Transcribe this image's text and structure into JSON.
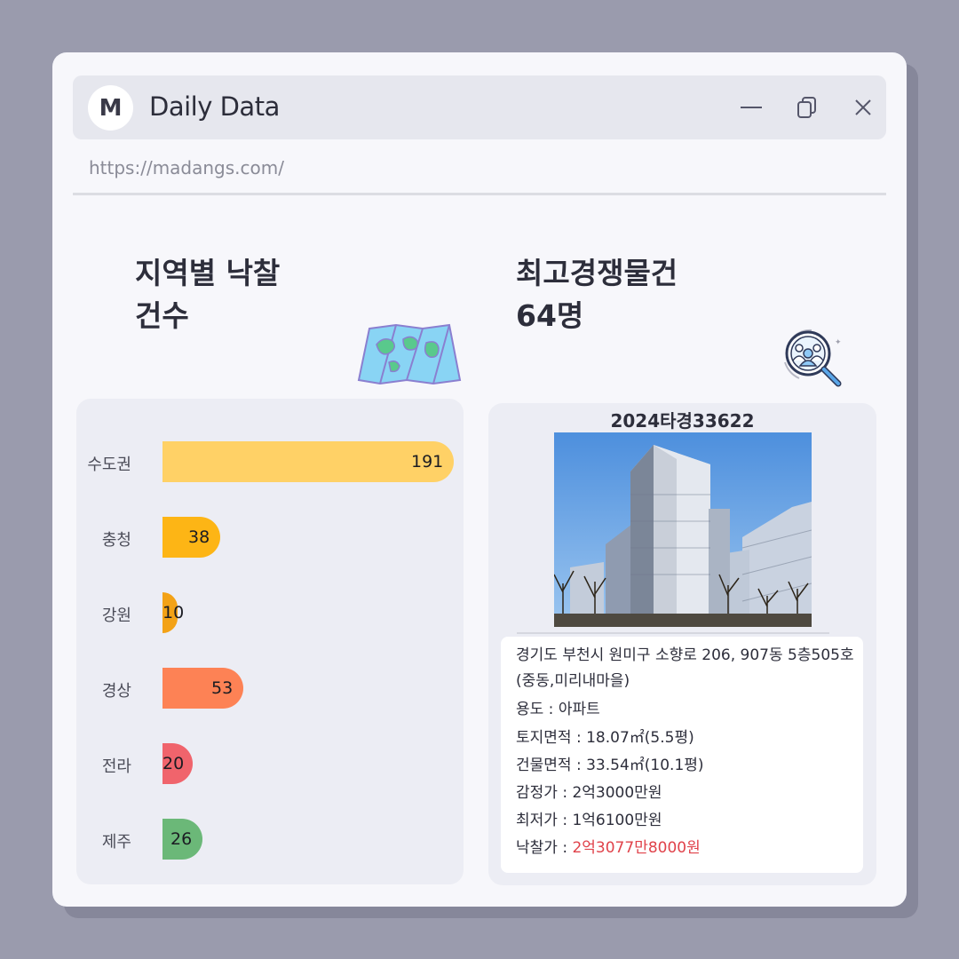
{
  "window": {
    "logo_letter": "M",
    "title": "Daily Data",
    "url": "https://madangs.com/",
    "icons": [
      "minimize-icon",
      "copy-icon",
      "close-icon"
    ]
  },
  "left": {
    "title_line1": "지역별 낙찰",
    "title_line2": "건수",
    "icon": "map-icon"
  },
  "right": {
    "title_line1": "최고경쟁물건",
    "title_line2": "64명",
    "icon": "search-people-icon",
    "case_number": "2024타경33622",
    "address_line1": "경기도 부천시 원미구 소향로 206, 907동 5층505호",
    "address_line2": "(중동,미리내마을)",
    "usage_label": "용도 : ",
    "usage_value": "아파트",
    "land_label": "토지면적 : ",
    "land_value": "18.07㎡(5.5평)",
    "building_label": "건물면적 : ",
    "building_value": "33.54㎡(10.1평)",
    "appraisal_label": "감정가 : ",
    "appraisal_value": "2억3000만원",
    "minimum_label": "최저가 : ",
    "minimum_value": "1억6100만원",
    "winning_label": "낙찰가 : ",
    "winning_value": "2억3077만8000원"
  },
  "colors": {
    "수도권": "#ffd166",
    "충청": "#fdb515",
    "강원": "#f3a216",
    "경상": "#fd8255",
    "전라": "#f0646c",
    "제주": "#6bb878",
    "highlight": "#e0424a"
  },
  "chart_data": {
    "type": "bar",
    "orientation": "horizontal",
    "categories": [
      "수도권",
      "충청",
      "강원",
      "경상",
      "전라",
      "제주"
    ],
    "values": [
      191,
      38,
      10,
      53,
      20,
      26
    ],
    "xlim": [
      0,
      191
    ],
    "grid": false,
    "data_labels": true
  }
}
